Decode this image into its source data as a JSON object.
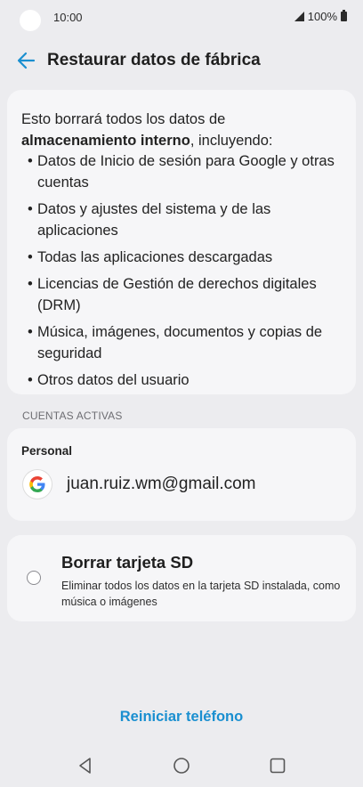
{
  "status_bar": {
    "time": "10:00",
    "battery": "100%"
  },
  "header": {
    "title": "Restaurar datos de fábrica"
  },
  "info": {
    "intro_prefix": "Esto borrará todos los datos de",
    "intro_bold": "almacenamiento interno",
    "intro_suffix": ", incluyendo:",
    "items": [
      "Datos de Inicio de sesión para Google y otras cuentas",
      "Datos y ajustes del sistema y de las aplicaciones",
      "Todas las aplicaciones descargadas",
      "Licencias de Gestión de derechos digitales (DRM)",
      "Música, imágenes, documentos y copias de seguridad",
      "Otros datos del usuario"
    ]
  },
  "accounts": {
    "section_label": "CUENTAS ACTIVAS",
    "group_label": "Personal",
    "email": "juan.ruiz.wm@gmail.com",
    "icon": "google-icon"
  },
  "sd_card": {
    "title": "Borrar tarjeta SD",
    "description": "Eliminar todos los datos en la tarjeta SD instalada, como música o imágenes",
    "checked": false
  },
  "actions": {
    "reset_label": "Reiniciar teléfono"
  },
  "colors": {
    "accent": "#1a8fd0",
    "background": "#ececef",
    "card": "#f6f6f8"
  }
}
